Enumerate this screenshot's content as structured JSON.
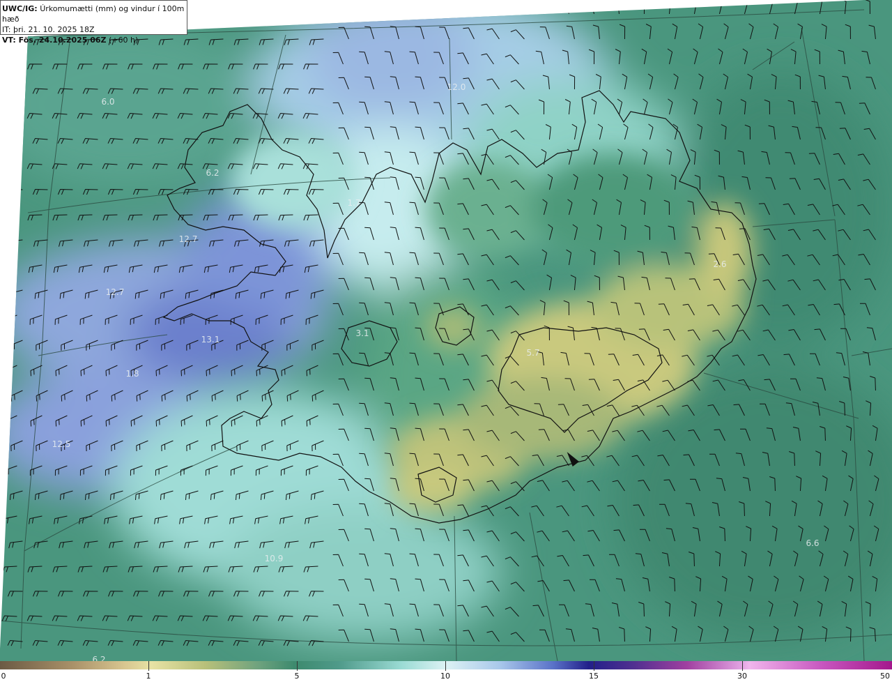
{
  "header": {
    "line1_bold": "UWC/IG:",
    "line1_text": "Úrkomumætti (mm) og vindur í 100m hæð",
    "line2": "IT: þri. 21. 10. 2025 18Z",
    "line3_bold": "VT: Fös. 24.10.2025 06Z",
    "line3_text": "(+60 h)"
  },
  "colorbar": {
    "ticks": [
      "0",
      "1",
      "5",
      "10",
      "15",
      "30",
      "50"
    ]
  },
  "map_labels": [
    "6.0",
    "12.0",
    "12.7",
    "12.7",
    "13.1",
    "12.5",
    "10.9",
    "6.6",
    "2.6",
    "6.2",
    "1.7",
    "3.1",
    "6.2",
    "5.7",
    "1.8"
  ],
  "colors": {
    "ocean_dark": "#3f8a74",
    "ocean_mid": "#5fa690",
    "light_cyan": "#bde8e4",
    "blue": "#7f9ad8",
    "dark_blue": "#5f70c4",
    "yellow_green": "#c4c77a",
    "coast": "#111111"
  }
}
